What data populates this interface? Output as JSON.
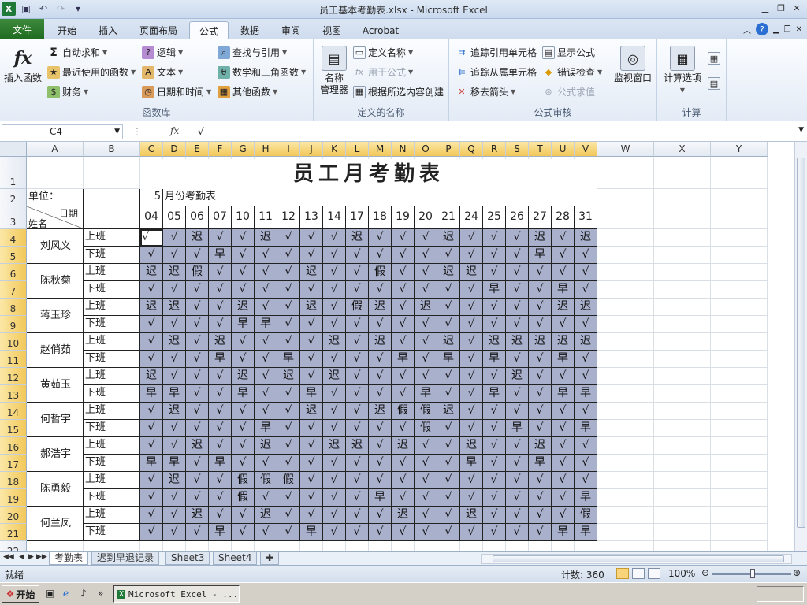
{
  "window": {
    "title": "员工基本考勤表.xlsx - Microsoft Excel"
  },
  "tabs": {
    "file": "文件",
    "items": [
      "开始",
      "插入",
      "页面布局",
      "公式",
      "数据",
      "审阅",
      "视图",
      "Acrobat"
    ],
    "active": "公式"
  },
  "ribbon": {
    "insert_function": "插入函数",
    "autosum": "自动求和",
    "recent": "最近使用的函数",
    "finance": "财务",
    "logic": "逻辑",
    "text": "文本",
    "datetime": "日期和时间",
    "lookup": "查找与引用",
    "math": "数学和三角函数",
    "other_func": "其他函数",
    "group_library": "函数库",
    "name_manager_1": "名称",
    "name_manager_2": "管理器",
    "define_name": "定义名称",
    "use_in_formula": "用于公式",
    "create_from_selection": "根据所选内容创建",
    "group_names": "定义的名称",
    "trace_precedents": "追踪引用单元格",
    "trace_dependents": "追踪从属单元格",
    "remove_arrows": "移去箭头",
    "show_formulas": "显示公式",
    "error_checking": "错误检查",
    "evaluate_formula": "公式求值",
    "watch_window": "监视窗口",
    "group_audit": "公式审核",
    "calc_options": "计算选项",
    "group_calc": "计算"
  },
  "formula_bar": {
    "name_box": "C4",
    "fx": "fx",
    "content": "√"
  },
  "columns": [
    "A",
    "B",
    "C",
    "D",
    "E",
    "F",
    "G",
    "H",
    "I",
    "J",
    "K",
    "L",
    "M",
    "N",
    "O",
    "P",
    "Q",
    "R",
    "S",
    "T",
    "U",
    "V",
    "W",
    "X",
    "Y"
  ],
  "rows": [
    "1",
    "2",
    "3",
    "4",
    "5",
    "6",
    "7",
    "8",
    "9",
    "10",
    "11",
    "12",
    "13",
    "14",
    "15",
    "16",
    "17",
    "18",
    "19",
    "20",
    "21",
    "22"
  ],
  "sheet": {
    "title": "员工月考勤表",
    "unit_label": "单位：",
    "month": "5",
    "month_label": "月份考勤表",
    "header_date": "日期",
    "header_name": "姓名",
    "dates": [
      "04",
      "05",
      "06",
      "07",
      "10",
      "11",
      "12",
      "13",
      "14",
      "17",
      "18",
      "19",
      "20",
      "21",
      "24",
      "25",
      "26",
      "27",
      "28",
      "31"
    ],
    "shift_on": "上班",
    "shift_off": "下班",
    "employees": [
      {
        "name": "刘风义",
        "on": [
          "√",
          "√",
          "迟",
          "√",
          "√",
          "迟",
          "√",
          "√",
          "√",
          "迟",
          "√",
          "√",
          "√",
          "迟",
          "√",
          "√",
          "√",
          "迟",
          "√",
          "迟"
        ],
        "off": [
          "√",
          "√",
          "√",
          "早",
          "√",
          "√",
          "√",
          "√",
          "√",
          "√",
          "√",
          "√",
          "√",
          "√",
          "√",
          "√",
          "√",
          "早",
          "√",
          "√"
        ]
      },
      {
        "name": "陈秋菊",
        "on": [
          "迟",
          "迟",
          "假",
          "√",
          "√",
          "√",
          "√",
          "迟",
          "√",
          "√",
          "假",
          "√",
          "√",
          "迟",
          "迟",
          "√",
          "√",
          "√",
          "√",
          "√"
        ],
        "off": [
          "√",
          "√",
          "√",
          "√",
          "√",
          "√",
          "√",
          "√",
          "√",
          "√",
          "√",
          "√",
          "√",
          "√",
          "√",
          "早",
          "√",
          "√",
          "早",
          "√"
        ]
      },
      {
        "name": "蒋玉珍",
        "on": [
          "迟",
          "迟",
          "√",
          "√",
          "迟",
          "√",
          "√",
          "迟",
          "√",
          "假",
          "迟",
          "√",
          "迟",
          "√",
          "√",
          "√",
          "√",
          "√",
          "迟",
          "迟"
        ],
        "off": [
          "√",
          "√",
          "√",
          "√",
          "早",
          "早",
          "√",
          "√",
          "√",
          "√",
          "√",
          "√",
          "√",
          "√",
          "√",
          "√",
          "√",
          "√",
          "√",
          "√"
        ]
      },
      {
        "name": "赵俏茹",
        "on": [
          "√",
          "迟",
          "√",
          "迟",
          "√",
          "√",
          "√",
          "√",
          "迟",
          "√",
          "迟",
          "√",
          "√",
          "迟",
          "√",
          "迟",
          "迟",
          "迟",
          "迟",
          "迟"
        ],
        "off": [
          "√",
          "√",
          "√",
          "早",
          "√",
          "√",
          "早",
          "√",
          "√",
          "√",
          "√",
          "早",
          "√",
          "早",
          "√",
          "早",
          "√",
          "√",
          "早",
          "√"
        ]
      },
      {
        "name": "黄茹玉",
        "on": [
          "迟",
          "√",
          "√",
          "√",
          "迟",
          "√",
          "迟",
          "√",
          "迟",
          "√",
          "√",
          "√",
          "√",
          "√",
          "√",
          "√",
          "迟",
          "√",
          "√",
          "√"
        ],
        "off": [
          "早",
          "早",
          "√",
          "√",
          "早",
          "√",
          "√",
          "早",
          "√",
          "√",
          "√",
          "√",
          "早",
          "√",
          "√",
          "早",
          "√",
          "√",
          "早",
          "早"
        ]
      },
      {
        "name": "何哲宇",
        "on": [
          "√",
          "迟",
          "√",
          "√",
          "√",
          "√",
          "√",
          "迟",
          "√",
          "√",
          "迟",
          "假",
          "假",
          "迟",
          "√",
          "√",
          "√",
          "√",
          "√",
          "√"
        ],
        "off": [
          "√",
          "√",
          "√",
          "√",
          "√",
          "早",
          "√",
          "√",
          "√",
          "√",
          "√",
          "√",
          "假",
          "√",
          "√",
          "√",
          "早",
          "√",
          "√",
          "早"
        ]
      },
      {
        "name": "郝浩宇",
        "on": [
          "√",
          "√",
          "迟",
          "√",
          "√",
          "迟",
          "√",
          "√",
          "迟",
          "迟",
          "√",
          "迟",
          "√",
          "√",
          "迟",
          "√",
          "√",
          "迟",
          "√",
          "√"
        ],
        "off": [
          "早",
          "早",
          "√",
          "早",
          "√",
          "√",
          "√",
          "√",
          "√",
          "√",
          "√",
          "√",
          "√",
          "√",
          "早",
          "√",
          "√",
          "早",
          "√",
          "√"
        ]
      },
      {
        "name": "陈勇毅",
        "on": [
          "√",
          "迟",
          "√",
          "√",
          "假",
          "假",
          "假",
          "√",
          "√",
          "√",
          "√",
          "√",
          "√",
          "√",
          "√",
          "√",
          "√",
          "√",
          "√",
          "√"
        ],
        "off": [
          "√",
          "√",
          "√",
          "√",
          "假",
          "√",
          "√",
          "√",
          "√",
          "√",
          "早",
          "√",
          "√",
          "√",
          "√",
          "√",
          "√",
          "√",
          "√",
          "早"
        ]
      },
      {
        "name": "何兰凤",
        "on": [
          "√",
          "√",
          "迟",
          "√",
          "√",
          "迟",
          "√",
          "√",
          "√",
          "√",
          "√",
          "迟",
          "√",
          "√",
          "迟",
          "√",
          "√",
          "√",
          "√",
          "假"
        ],
        "off": [
          "√",
          "√",
          "√",
          "早",
          "√",
          "√",
          "√",
          "早",
          "√",
          "√",
          "√",
          "√",
          "√",
          "√",
          "√",
          "√",
          "√",
          "√",
          "早",
          "早"
        ]
      }
    ]
  },
  "sheet_tabs": [
    "考勤表",
    "迟到早退记录",
    "Sheet3",
    "Sheet4"
  ],
  "status": {
    "ready": "就绪",
    "count": "计数: 360",
    "zoom": "100%"
  },
  "taskbar": {
    "start": "开始",
    "excel_task": "Microsoft Excel - ..."
  }
}
